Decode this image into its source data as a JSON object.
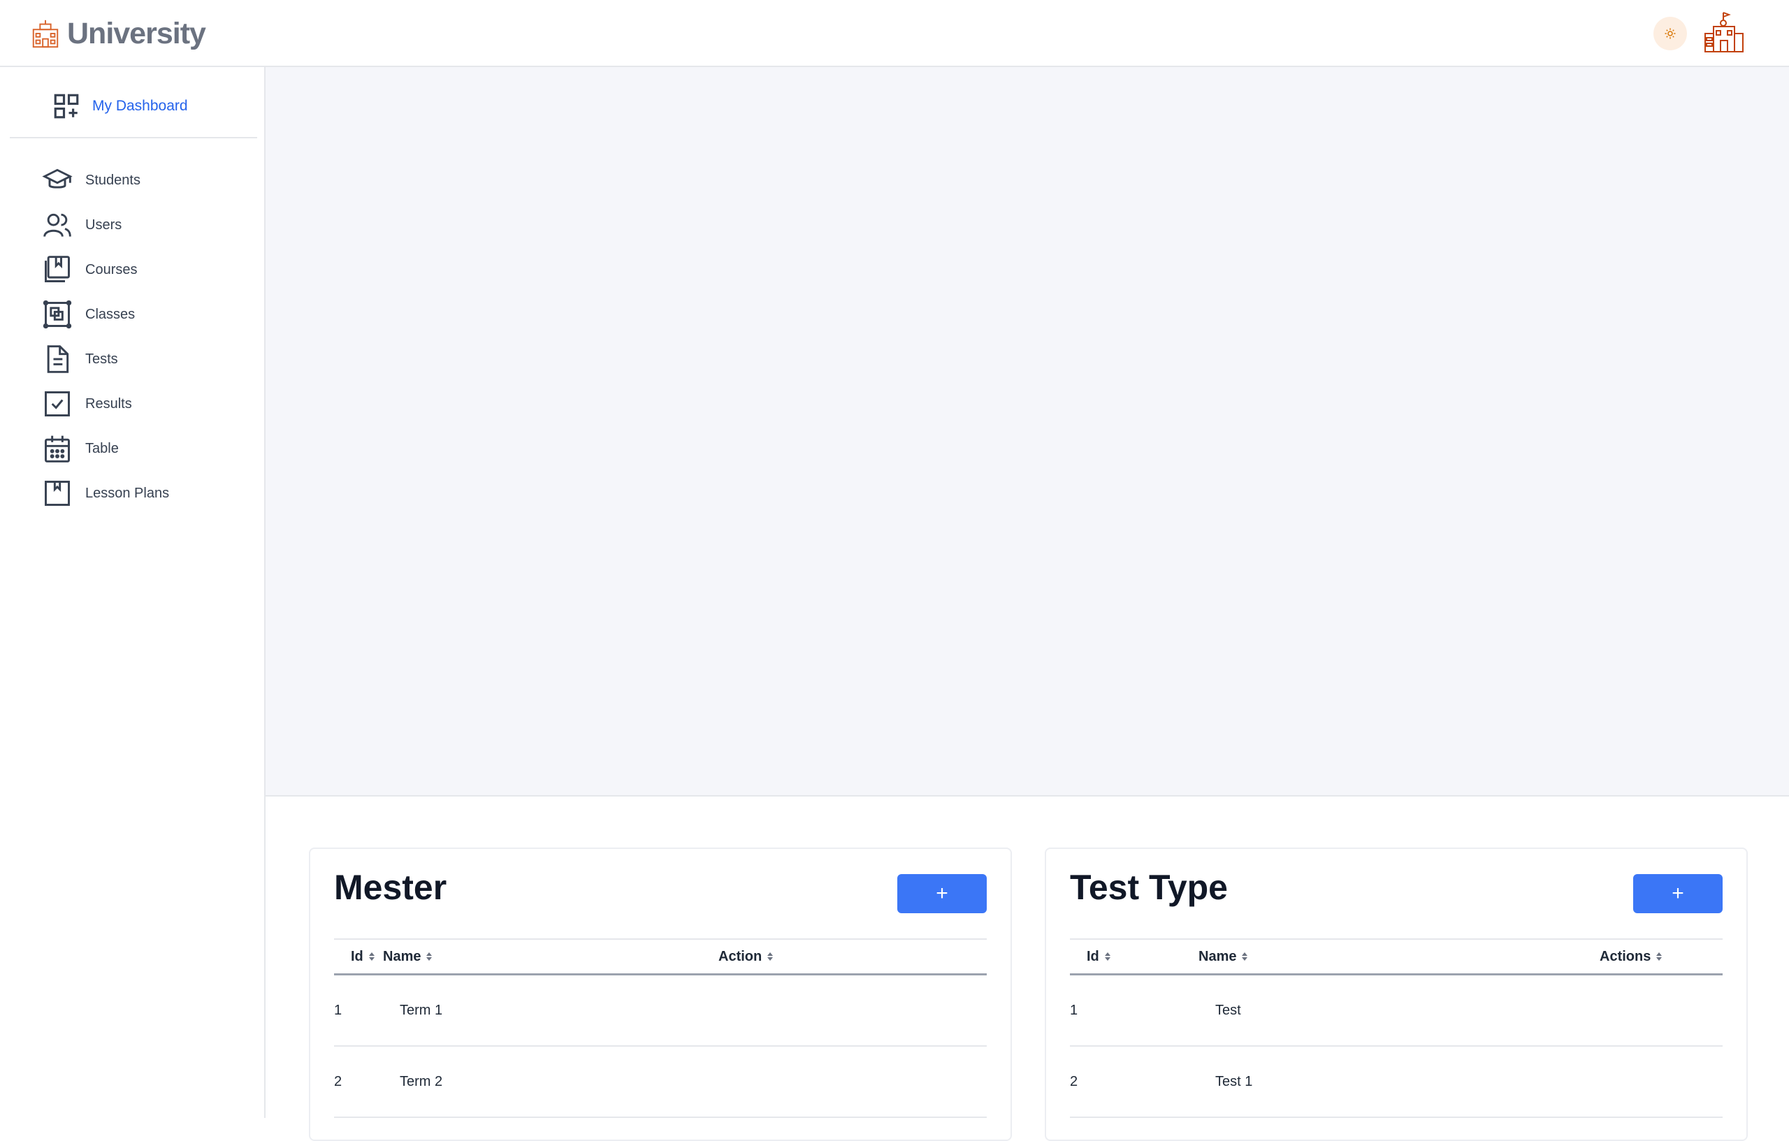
{
  "header": {
    "app_title": "University"
  },
  "sidebar": {
    "dashboard_label": "My Dashboard",
    "items": [
      {
        "label": "Students",
        "icon": "graduation-cap-icon"
      },
      {
        "label": "Users",
        "icon": "users-icon"
      },
      {
        "label": "Courses",
        "icon": "book-icon"
      },
      {
        "label": "Classes",
        "icon": "layers-square-icon"
      },
      {
        "label": "Tests",
        "icon": "document-icon"
      },
      {
        "label": "Results",
        "icon": "checkbox-icon"
      },
      {
        "label": "Table",
        "icon": "calendar-icon"
      },
      {
        "label": "Lesson Plans",
        "icon": "bookmark-square-icon"
      }
    ]
  },
  "mester": {
    "title": "Mester",
    "add_label": "+",
    "columns": [
      "Id",
      "Name",
      "Action"
    ],
    "rows": [
      {
        "id": "1",
        "name": "Term 1"
      },
      {
        "id": "2",
        "name": "Term 2"
      }
    ]
  },
  "test_type": {
    "title": "Test Type",
    "add_label": "+",
    "columns": [
      "Id",
      "Name",
      "Actions"
    ],
    "rows": [
      {
        "id": "1",
        "name": "Test"
      },
      {
        "id": "2",
        "name": "Test 1"
      }
    ]
  },
  "colors": {
    "accent": "#3b76f6",
    "brand": "#c2410c",
    "link": "#2563eb",
    "panel": "#f5f6fa"
  }
}
